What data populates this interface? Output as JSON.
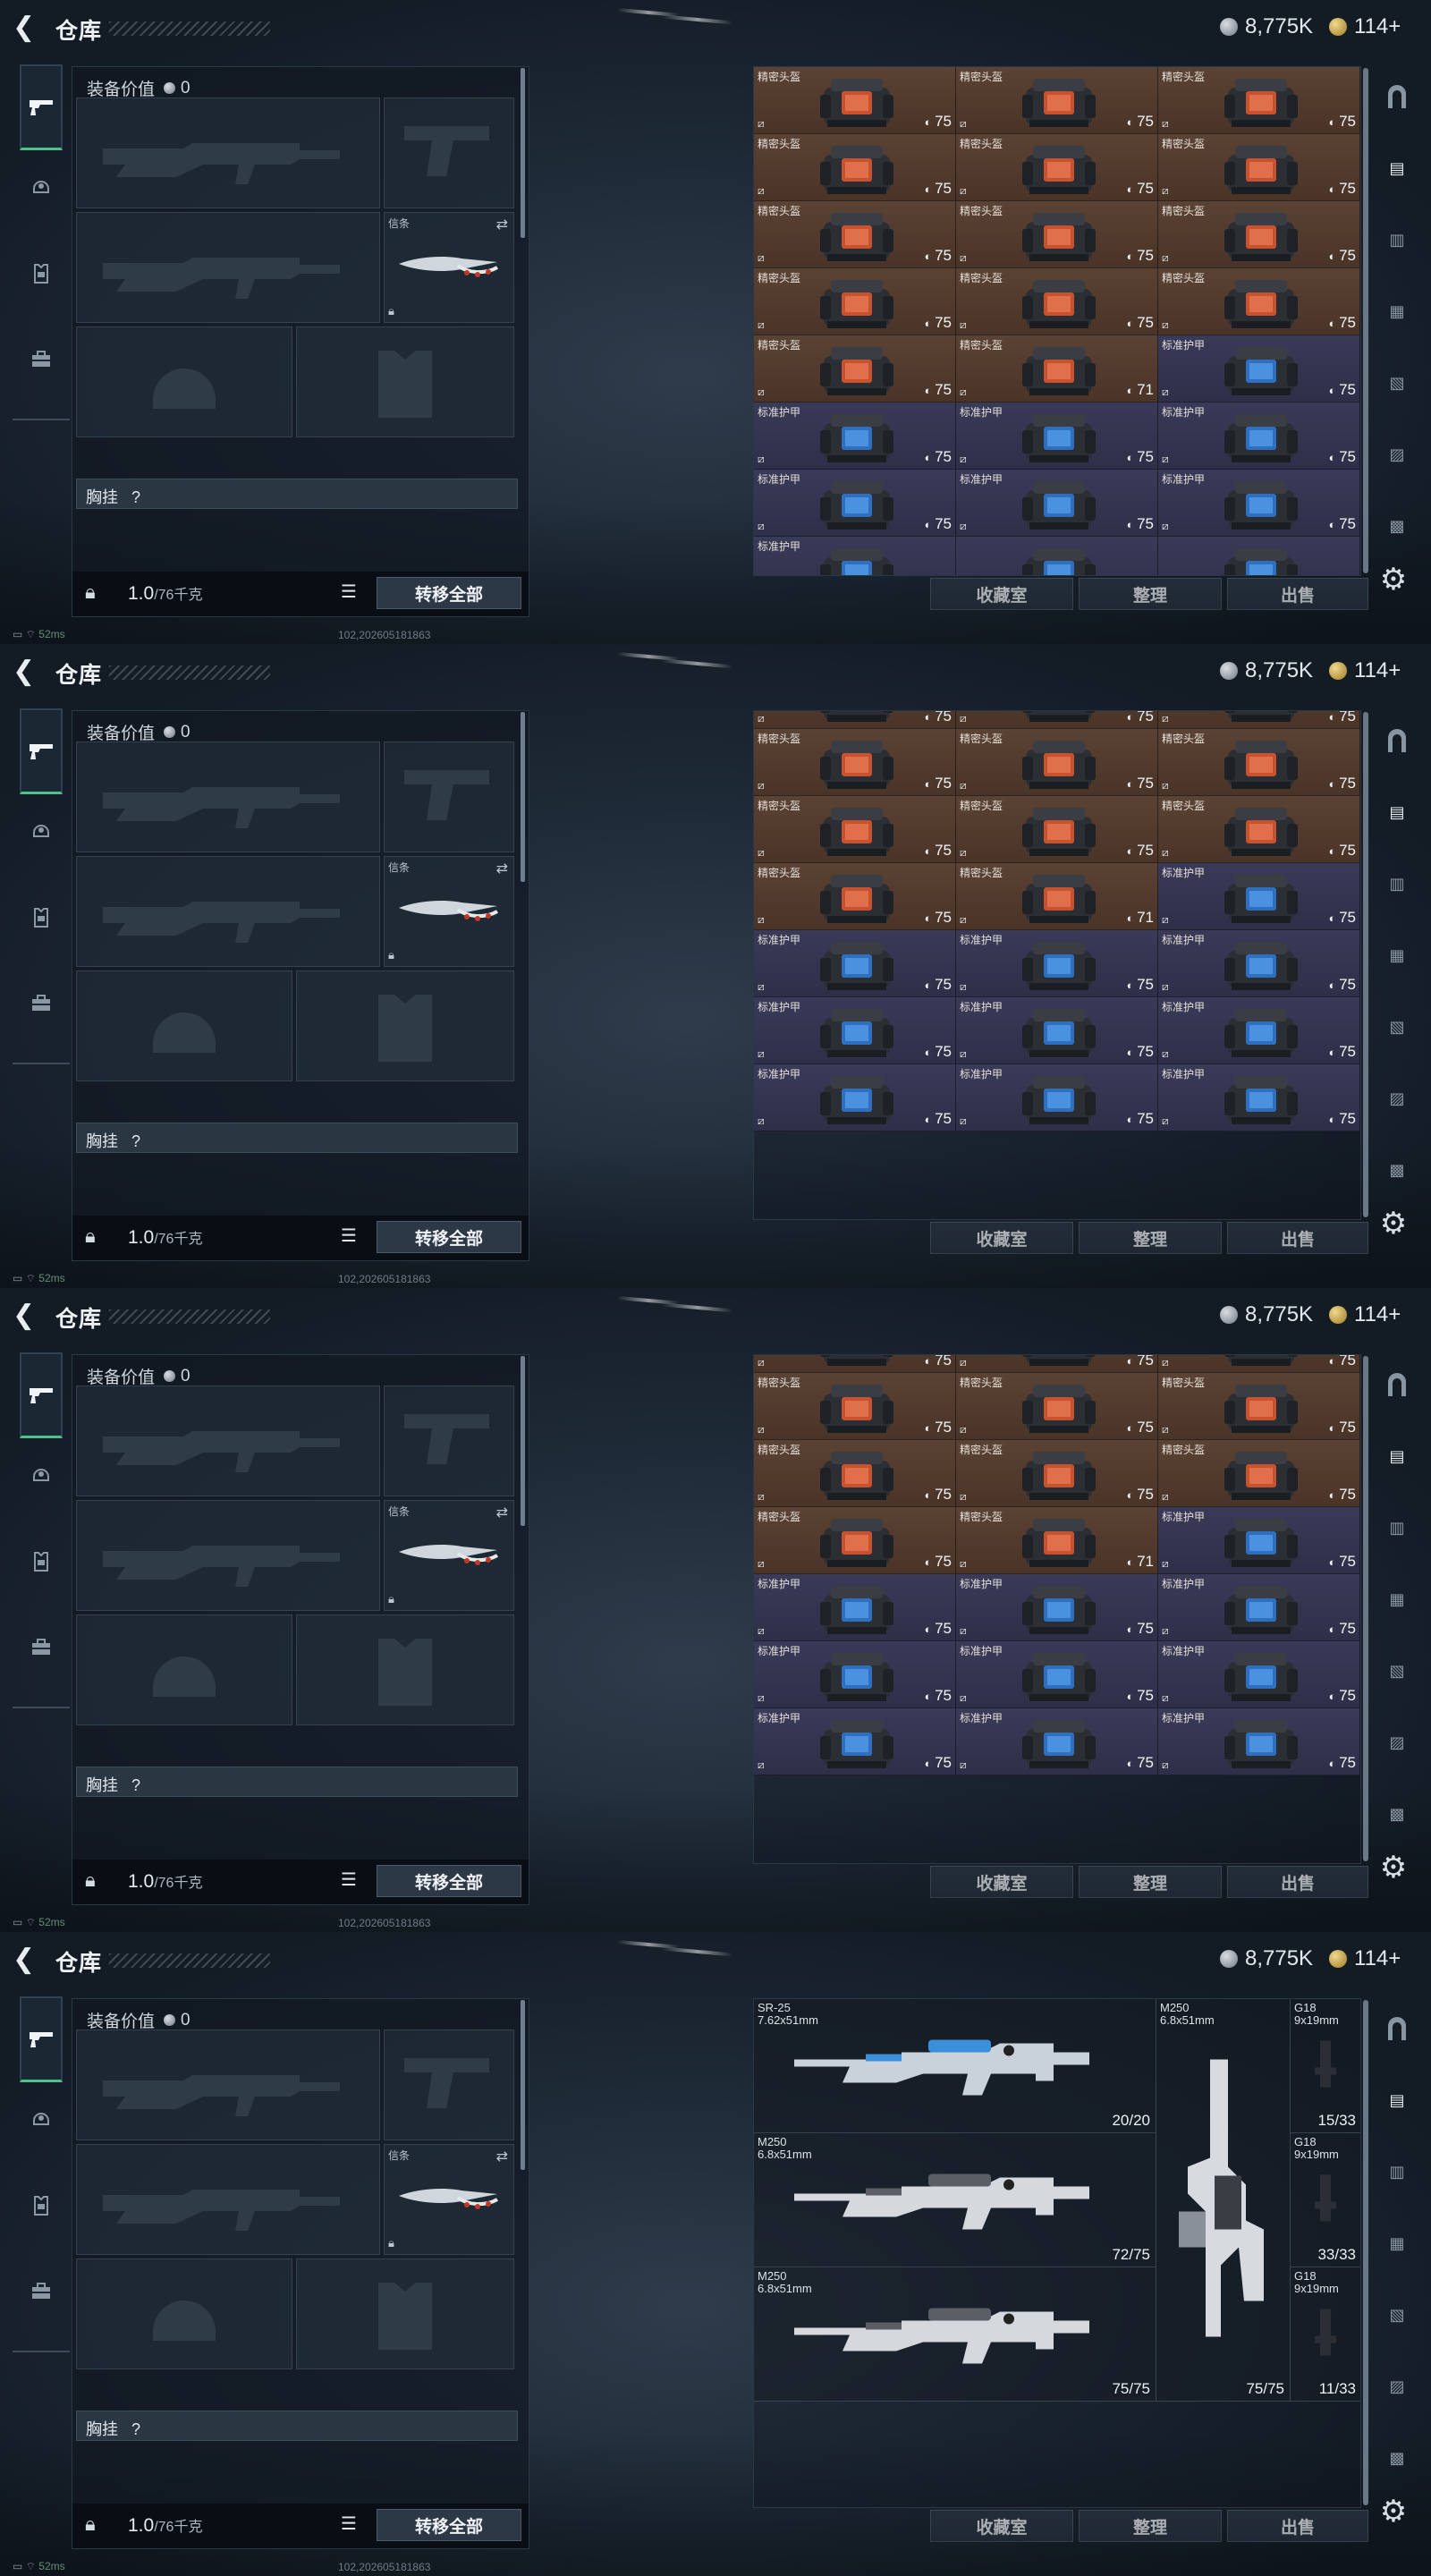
{
  "header": {
    "back_label": "❮",
    "title": "仓库",
    "silver": "8,775K",
    "gold": "114+"
  },
  "loadout": {
    "equip_value_label": "装备价值",
    "equip_value": "0",
    "melee_label": "信条",
    "chest_rig_label": "胸挂",
    "chest_rig_help": "?",
    "weight_current": "1.0",
    "weight_max": "/76千克",
    "transfer_all_label": "转移全部"
  },
  "actions": {
    "collection_label": "收藏室",
    "sort_label": "整理",
    "sell_label": "出售"
  },
  "status": {
    "ping": "52ms",
    "uid": "102,202605181863"
  },
  "item_names": {
    "helmet": "精密头盔",
    "armor": "标准护甲"
  },
  "grids": [
    {
      "rows": [
        [
          {
            "type": "h",
            "name": "精密头盔",
            "dur": "75"
          },
          {
            "type": "h",
            "name": "精密头盔",
            "dur": "75"
          },
          {
            "type": "h",
            "name": "精密头盔",
            "dur": "75"
          }
        ],
        [
          {
            "type": "h",
            "name": "精密头盔",
            "dur": "75"
          },
          {
            "type": "h",
            "name": "精密头盔",
            "dur": "75"
          },
          {
            "type": "h",
            "name": "精密头盔",
            "dur": "75"
          }
        ],
        [
          {
            "type": "h",
            "name": "精密头盔",
            "dur": "75"
          },
          {
            "type": "h",
            "name": "精密头盔",
            "dur": "75"
          },
          {
            "type": "h",
            "name": "精密头盔",
            "dur": "75"
          }
        ],
        [
          {
            "type": "h",
            "name": "精密头盔",
            "dur": "75"
          },
          {
            "type": "h",
            "name": "精密头盔",
            "dur": "75"
          },
          {
            "type": "h",
            "name": "精密头盔",
            "dur": "75"
          }
        ],
        [
          {
            "type": "h",
            "name": "精密头盔",
            "dur": "75"
          },
          {
            "type": "h",
            "name": "精密头盔",
            "dur": "71"
          },
          {
            "type": "a",
            "name": "标准护甲",
            "dur": "75"
          }
        ],
        [
          {
            "type": "a",
            "name": "标准护甲",
            "dur": "75"
          },
          {
            "type": "a",
            "name": "标准护甲",
            "dur": "75"
          },
          {
            "type": "a",
            "name": "标准护甲",
            "dur": "75"
          }
        ],
        [
          {
            "type": "a",
            "name": "标准护甲",
            "dur": "75"
          },
          {
            "type": "a",
            "name": "标准护甲",
            "dur": "75"
          },
          {
            "type": "a",
            "name": "标准护甲",
            "dur": "75"
          }
        ],
        [
          {
            "type": "a",
            "name": "标准护甲",
            "dur": ""
          },
          {
            "type": "a",
            "name": "",
            "dur": ""
          },
          {
            "type": "a",
            "name": "",
            "dur": ""
          }
        ]
      ]
    },
    {
      "rows": [
        [
          {
            "type": "h",
            "name": "",
            "dur": "75"
          },
          {
            "type": "h",
            "name": "",
            "dur": "75"
          },
          {
            "type": "h",
            "name": "",
            "dur": "75"
          }
        ],
        [
          {
            "type": "h",
            "name": "精密头盔",
            "dur": "75"
          },
          {
            "type": "h",
            "name": "精密头盔",
            "dur": "75"
          },
          {
            "type": "h",
            "name": "精密头盔",
            "dur": "75"
          }
        ],
        [
          {
            "type": "h",
            "name": "精密头盔",
            "dur": "75"
          },
          {
            "type": "h",
            "name": "精密头盔",
            "dur": "75"
          },
          {
            "type": "h",
            "name": "精密头盔",
            "dur": "75"
          }
        ],
        [
          {
            "type": "h",
            "name": "精密头盔",
            "dur": "75"
          },
          {
            "type": "h",
            "name": "精密头盔",
            "dur": "71"
          },
          {
            "type": "a",
            "name": "标准护甲",
            "dur": "75"
          }
        ],
        [
          {
            "type": "a",
            "name": "标准护甲",
            "dur": "75"
          },
          {
            "type": "a",
            "name": "标准护甲",
            "dur": "75"
          },
          {
            "type": "a",
            "name": "标准护甲",
            "dur": "75"
          }
        ],
        [
          {
            "type": "a",
            "name": "标准护甲",
            "dur": "75"
          },
          {
            "type": "a",
            "name": "标准护甲",
            "dur": "75"
          },
          {
            "type": "a",
            "name": "标准护甲",
            "dur": "75"
          }
        ],
        [
          {
            "type": "a",
            "name": "标准护甲",
            "dur": "75"
          },
          {
            "type": "a",
            "name": "标准护甲",
            "dur": "75"
          },
          {
            "type": "a",
            "name": "标准护甲",
            "dur": "75"
          }
        ]
      ]
    },
    {
      "rows": [
        [
          {
            "type": "h",
            "name": "",
            "dur": "75"
          },
          {
            "type": "h",
            "name": "",
            "dur": "75"
          },
          {
            "type": "h",
            "name": "",
            "dur": "75"
          }
        ],
        [
          {
            "type": "h",
            "name": "精密头盔",
            "dur": "75"
          },
          {
            "type": "h",
            "name": "精密头盔",
            "dur": "75"
          },
          {
            "type": "h",
            "name": "精密头盔",
            "dur": "75"
          }
        ],
        [
          {
            "type": "h",
            "name": "精密头盔",
            "dur": "75"
          },
          {
            "type": "h",
            "name": "精密头盔",
            "dur": "75"
          },
          {
            "type": "h",
            "name": "精密头盔",
            "dur": "75"
          }
        ],
        [
          {
            "type": "h",
            "name": "精密头盔",
            "dur": "75"
          },
          {
            "type": "h",
            "name": "精密头盔",
            "dur": "71"
          },
          {
            "type": "a",
            "name": "标准护甲",
            "dur": "75"
          }
        ],
        [
          {
            "type": "a",
            "name": "标准护甲",
            "dur": "75"
          },
          {
            "type": "a",
            "name": "标准护甲",
            "dur": "75"
          },
          {
            "type": "a",
            "name": "标准护甲",
            "dur": "75"
          }
        ],
        [
          {
            "type": "a",
            "name": "标准护甲",
            "dur": "75"
          },
          {
            "type": "a",
            "name": "标准护甲",
            "dur": "75"
          },
          {
            "type": "a",
            "name": "标准护甲",
            "dur": "75"
          }
        ],
        [
          {
            "type": "a",
            "name": "标准护甲",
            "dur": "75"
          },
          {
            "type": "a",
            "name": "标准护甲",
            "dur": "75"
          },
          {
            "type": "a",
            "name": "标准护甲",
            "dur": "75"
          }
        ]
      ]
    }
  ],
  "weapons": [
    {
      "name": "SR-25\n7.62x51mm",
      "ammo": "20/20"
    },
    {
      "name": "M250\n6.8x51mm",
      "ammo": "72/75"
    },
    {
      "name": "M250\n6.8x51mm",
      "ammo": "75/75"
    },
    {
      "name": "M250\n6.8x51mm",
      "ammo": "75/75"
    },
    {
      "name": "G18\n9x19mm",
      "ammo": "15/33"
    },
    {
      "name": "G18\n9x19mm",
      "ammo": "33/33"
    },
    {
      "name": "G18\n9x19mm",
      "ammo": "11/33"
    }
  ],
  "colors": {
    "helmet_tile": "#523b2e",
    "armor_tile": "#34364f",
    "active_tab": "#4cc38a"
  }
}
